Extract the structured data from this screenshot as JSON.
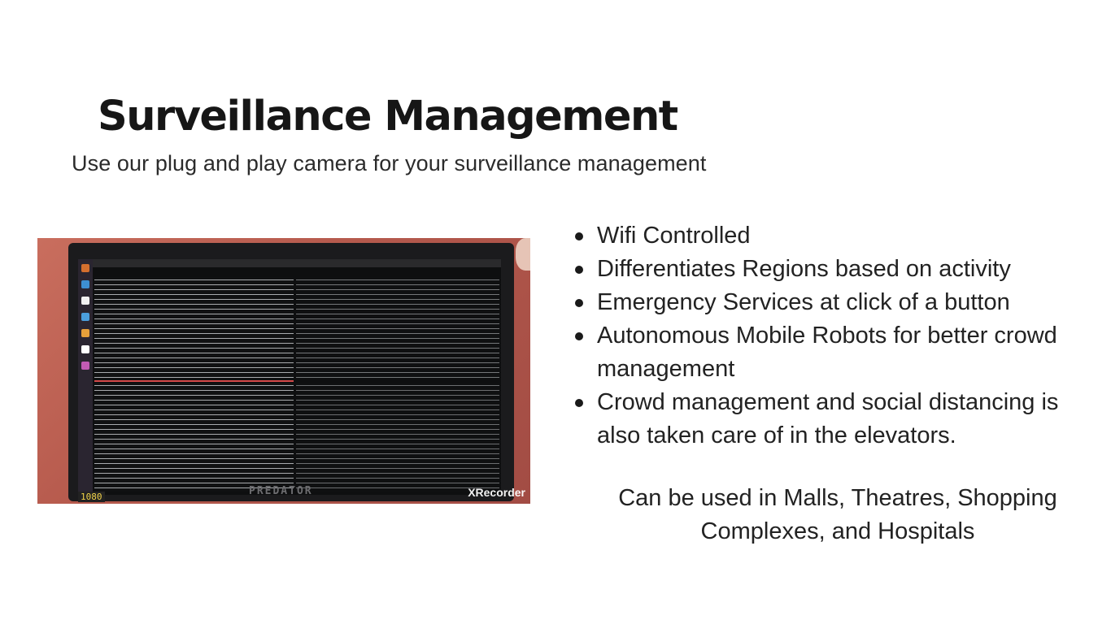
{
  "header": {
    "title": "Surveillance Management",
    "subtitle": "Use our plug and play camera for your surveillance management"
  },
  "photo": {
    "brand_text": "PREDATOR",
    "watermark": "XRecorder",
    "badge": "1080"
  },
  "features": [
    "Wifi Controlled",
    "Differentiates Regions based on activity",
    "Emergency Services at click of a button",
    "Autonomous Mobile Robots for better crowd management",
    "Crowd management and social distancing is also taken care of in the elevators."
  ],
  "usage_note": "Can be used in Malls, Theatres, Shopping Complexes, and Hospitals"
}
